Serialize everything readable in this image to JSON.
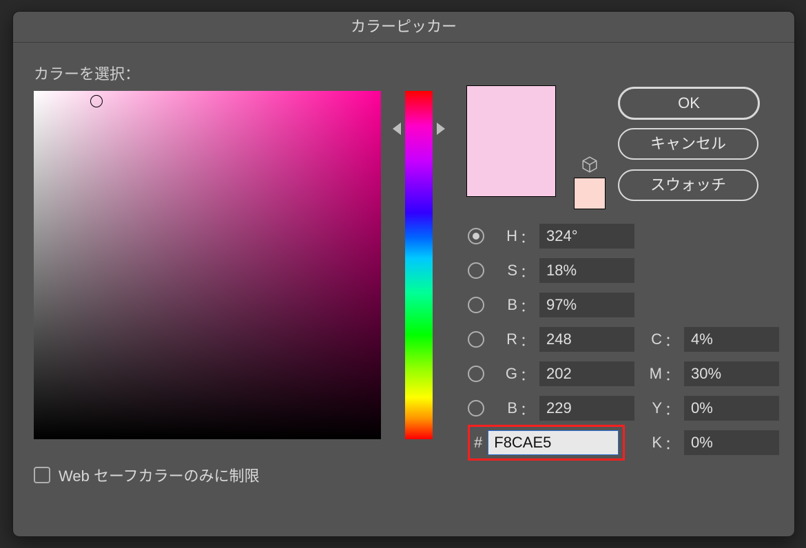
{
  "title": "カラーピッカー",
  "prompt": "カラーを選択：",
  "buttons": {
    "ok": "OK",
    "cancel": "キャンセル",
    "swatch": "スウォッチ"
  },
  "current_color_hex": "#F8CAE5",
  "old_color_hex": "#FCD8D0",
  "hue_slider_percent": 10,
  "sv_cursor": {
    "x_percent": 18,
    "y_percent": 3
  },
  "hsb": {
    "h_label": "H",
    "h_value": "324°",
    "s_label": "S",
    "s_value": "18%",
    "b_label": "B",
    "b_value": "97%"
  },
  "rgb": {
    "r_label": "R",
    "r_value": "248",
    "g_label": "G",
    "g_value": "202",
    "b_label": "B",
    "b_value": "229"
  },
  "hex": {
    "hash": "#",
    "value": "F8CAE5"
  },
  "cmyk": {
    "c_label": "C",
    "c_value": "4%",
    "m_label": "M",
    "m_value": "30%",
    "y_label": "Y",
    "y_value": "0%",
    "k_label": "K",
    "k_value": "0%"
  },
  "web_safe_label": "Web セーフカラーのみに制限",
  "cube_icon_name": "cube-icon"
}
